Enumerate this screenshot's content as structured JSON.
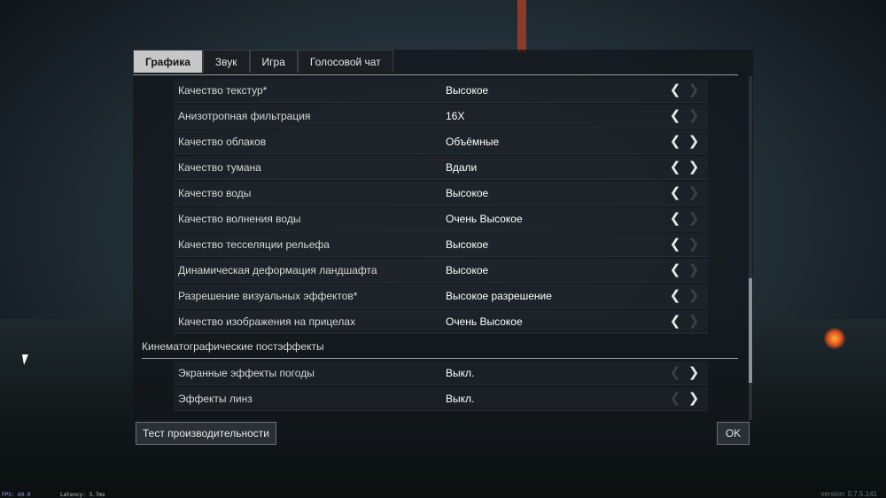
{
  "tabs": [
    {
      "label": "Графика",
      "active": true
    },
    {
      "label": "Звук",
      "active": false
    },
    {
      "label": "Игра",
      "active": false
    },
    {
      "label": "Голосовой чат",
      "active": false
    }
  ],
  "settings": [
    {
      "label": "Качество текстур*",
      "value": "Высокое",
      "left": true,
      "right": false
    },
    {
      "label": "Анизотропная фильтрация",
      "value": "16X",
      "left": true,
      "right": false
    },
    {
      "label": "Качество облаков",
      "value": "Объёмные",
      "left": true,
      "right": true
    },
    {
      "label": "Качество тумана",
      "value": "Вдали",
      "left": true,
      "right": true
    },
    {
      "label": "Качество воды",
      "value": "Высокое",
      "left": true,
      "right": false
    },
    {
      "label": "Качество волнения воды",
      "value": "Очень Высокое",
      "left": true,
      "right": false
    },
    {
      "label": "Качество тесселяции рельефа",
      "value": "Высокое",
      "left": true,
      "right": false
    },
    {
      "label": "Динамическая деформация ландшафта",
      "value": "Высокое",
      "left": true,
      "right": false
    },
    {
      "label": "Разрешение визуальных эффектов*",
      "value": "Высокое разрешение",
      "left": true,
      "right": false
    },
    {
      "label": "Качество изображения на прицелах",
      "value": "Очень Высокое",
      "left": true,
      "right": false
    }
  ],
  "section": {
    "title": "Кинематографические постэффекты"
  },
  "post_settings": [
    {
      "label": "Экранные эффекты погоды",
      "value": "Выкл.",
      "left": false,
      "right": true
    },
    {
      "label": "Эффекты линз",
      "value": "Выкл.",
      "left": false,
      "right": true
    }
  ],
  "arrows": {
    "left": "❮",
    "right": "❯"
  },
  "buttons": {
    "benchmark": "Тест производительности",
    "ok": "OK"
  },
  "footer": {
    "fps": "FPS: 60.0",
    "latency": "Latency: 3.7ms",
    "version": "version: 0.7.5.141"
  }
}
